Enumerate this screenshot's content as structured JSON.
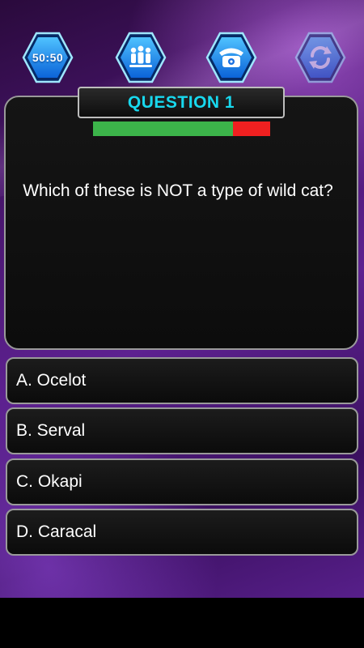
{
  "lifelines": [
    {
      "name": "fifty-fifty",
      "label": "50:50",
      "icon": "fifty-fifty-icon",
      "used": false
    },
    {
      "name": "ask-audience",
      "label": "",
      "icon": "audience-icon",
      "used": false
    },
    {
      "name": "phone-friend",
      "label": "",
      "icon": "phone-icon",
      "used": false
    },
    {
      "name": "switch-question",
      "label": "",
      "icon": "refresh-icon",
      "used": true
    }
  ],
  "question": {
    "badge": "QUESTION 1",
    "timer_remaining": 0.79,
    "text": "Which of these is NOT a type of wild cat?"
  },
  "answers": [
    {
      "label": "A. Ocelot"
    },
    {
      "label": "B. Serval"
    },
    {
      "label": "C. Okapi"
    },
    {
      "label": "D. Caracal"
    }
  ],
  "colors": {
    "badge_text": "#18d8ee",
    "timer_remaining": "#3cb44a",
    "timer_elapsed": "#f02020",
    "hex_blue": "#1a8fff"
  }
}
